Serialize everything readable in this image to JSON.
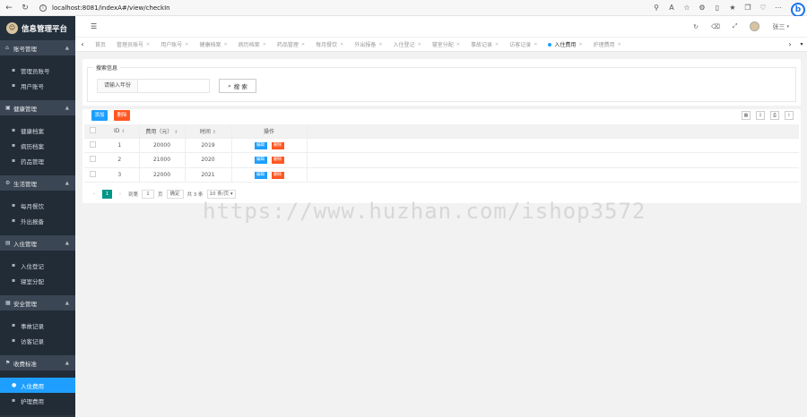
{
  "browser": {
    "url": "localhost:8081/indexA#/view/checkIn",
    "nav_back": "←",
    "nav_refresh": "↻",
    "info_icon": "i"
  },
  "sidebar": {
    "brand_title": "信息管理平台",
    "groups": [
      {
        "label": "账号管理",
        "items": [
          "管理员账号",
          "用户账号"
        ]
      },
      {
        "label": "健康管理",
        "items": [
          "健康档案",
          "病历档案",
          "药品管理"
        ]
      },
      {
        "label": "生活管理",
        "items": [
          "每月餐饮",
          "外出报备"
        ]
      },
      {
        "label": "入住管理",
        "items": [
          "入住登记",
          "寝室分配"
        ]
      },
      {
        "label": "安全管理",
        "items": [
          "事故记录",
          "访客记录"
        ]
      },
      {
        "label": "收费标准",
        "items": [
          "入住费用",
          "护理费用"
        ]
      }
    ],
    "active_item": "入住费用"
  },
  "header": {
    "user_name": "张三"
  },
  "tabs": [
    "首页",
    "管理员账号",
    "用户账号",
    "健康档案",
    "病历档案",
    "药品管理",
    "每月餐饮",
    "外出报备",
    "入住登记",
    "寝室分配",
    "事故记录",
    "访客记录",
    "入住费用",
    "护理费用"
  ],
  "active_tab": "入住费用",
  "search": {
    "legend": "搜索信息",
    "label": "请输入年份",
    "input_value": "",
    "button": "搜 索"
  },
  "toolbar": {
    "add": "添加",
    "delete": "删除"
  },
  "table": {
    "headers": {
      "id": "ID",
      "fee": "费用（元）",
      "time": "时间",
      "op": "操作"
    },
    "edit_label": "编辑",
    "delete_label": "删除",
    "rows": [
      {
        "id": "1",
        "fee": "20000",
        "time": "2019"
      },
      {
        "id": "2",
        "fee": "21000",
        "time": "2020"
      },
      {
        "id": "3",
        "fee": "22000",
        "time": "2021"
      }
    ]
  },
  "pager": {
    "current": "1",
    "goto_prefix": "到第",
    "goto_value": "1",
    "goto_suffix": "页",
    "ok": "确定",
    "total": "共 3 条",
    "page_size": "10 条/页"
  },
  "watermark": "https://www.huzhan.com/ishop3572"
}
